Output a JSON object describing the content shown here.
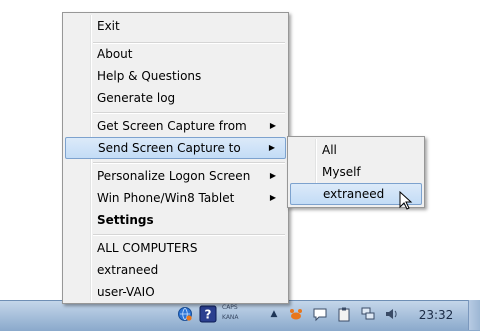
{
  "main_menu": {
    "items": [
      {
        "label": "Exit"
      },
      {
        "label": "About"
      },
      {
        "label": "Help & Questions"
      },
      {
        "label": "Generate log"
      },
      {
        "label": "Get Screen Capture from"
      },
      {
        "label": "Send Screen Capture to"
      },
      {
        "label": "Personalize Logon Screen"
      },
      {
        "label": "Win Phone/Win8 Tablet"
      },
      {
        "label": "Settings"
      },
      {
        "label": "ALL COMPUTERS"
      },
      {
        "label": "extraneed"
      },
      {
        "label": "user-VAIO"
      }
    ],
    "submenu_arrow": "▶"
  },
  "submenu": {
    "items": [
      {
        "label": "All"
      },
      {
        "label": "Myself"
      },
      {
        "label": "extraneed"
      }
    ]
  },
  "taskbar": {
    "ime_line1": "CAPS",
    "ime_line2": "KANA",
    "clock": "23:32",
    "tray_icons": [
      "globe-icon",
      "help-icon",
      "show-hidden-icons-icon",
      "crab-icon",
      "chat-bubble-icon",
      "clipboard-icon",
      "network-icon",
      "volume-icon"
    ]
  },
  "colors": {
    "menu_bg": "#f0f0f0",
    "highlight": "#c3dcf6",
    "highlight_border": "#7da2ce",
    "taskbar": "#9fb8d6"
  }
}
